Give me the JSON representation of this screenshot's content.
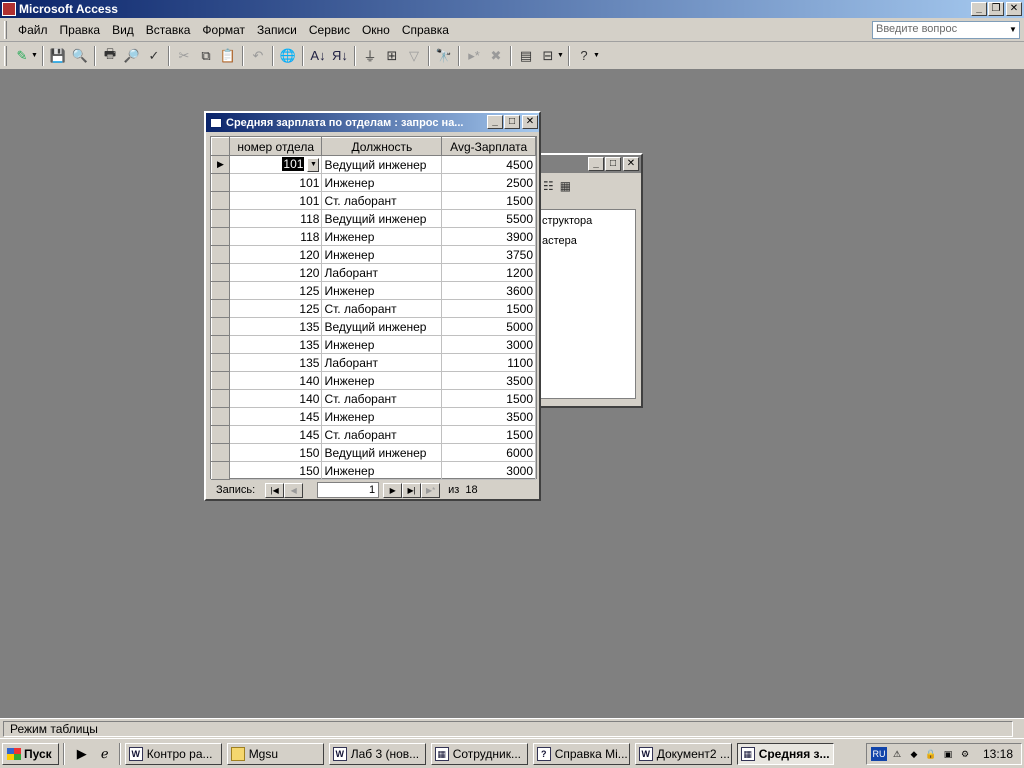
{
  "app": {
    "title": "Microsoft Access"
  },
  "menu": {
    "items": [
      "Файл",
      "Правка",
      "Вид",
      "Вставка",
      "Формат",
      "Записи",
      "Сервис",
      "Окно",
      "Справка"
    ],
    "question_placeholder": "Введите вопрос"
  },
  "toolbar": {
    "icons": [
      "design-view-icon",
      "save-icon",
      "file-search-icon",
      "print-icon",
      "print-preview-icon",
      "spelling-icon",
      "cut-icon",
      "copy-icon",
      "paste-icon",
      "undo-icon",
      "hyperlink-icon",
      "sort-ascending-icon",
      "sort-descending-icon",
      "filter-by-selection-icon",
      "filter-by-form-icon",
      "apply-filter-icon",
      "find-icon",
      "new-record-icon",
      "delete-record-icon",
      "database-window-icon",
      "new-object-icon",
      "help-icon"
    ]
  },
  "db_window": {
    "list_items": [
      "структора",
      "астера"
    ]
  },
  "query_window": {
    "title": "Средняя зарплата по отделам : запрос на...",
    "columns": [
      "номер отдела",
      "Должность",
      "Avg-Зарплата"
    ],
    "rows": [
      {
        "dept": "101",
        "position": "Ведущий инженер",
        "avg": "4500"
      },
      {
        "dept": "101",
        "position": "Инженер",
        "avg": "2500"
      },
      {
        "dept": "101",
        "position": "Ст. лаборант",
        "avg": "1500"
      },
      {
        "dept": "118",
        "position": "Ведущий инженер",
        "avg": "5500"
      },
      {
        "dept": "118",
        "position": "Инженер",
        "avg": "3900"
      },
      {
        "dept": "120",
        "position": "Инженер",
        "avg": "3750"
      },
      {
        "dept": "120",
        "position": "Лаборант",
        "avg": "1200"
      },
      {
        "dept": "125",
        "position": "Инженер",
        "avg": "3600"
      },
      {
        "dept": "125",
        "position": "Ст. лаборант",
        "avg": "1500"
      },
      {
        "dept": "135",
        "position": "Ведущий инженер",
        "avg": "5000"
      },
      {
        "dept": "135",
        "position": "Инженер",
        "avg": "3000"
      },
      {
        "dept": "135",
        "position": "Лаборант",
        "avg": "1100"
      },
      {
        "dept": "140",
        "position": "Инженер",
        "avg": "3500"
      },
      {
        "dept": "140",
        "position": "Ст. лаборант",
        "avg": "1500"
      },
      {
        "dept": "145",
        "position": "Инженер",
        "avg": "3500"
      },
      {
        "dept": "145",
        "position": "Ст. лаборант",
        "avg": "1500"
      },
      {
        "dept": "150",
        "position": "Ведущий инженер",
        "avg": "6000"
      },
      {
        "dept": "150",
        "position": "Инженер",
        "avg": "3000"
      }
    ],
    "nav": {
      "label": "Запись:",
      "current": "1",
      "of_label": "из",
      "total": "18"
    }
  },
  "status": {
    "text": "Режим таблицы"
  },
  "taskbar": {
    "start_label": "Пуск",
    "tasks": [
      {
        "label": "Контро ра...",
        "icon": "word-icon",
        "icon_char": "W"
      },
      {
        "label": "Mgsu",
        "icon": "folder-icon",
        "icon_char": ""
      },
      {
        "label": "Лаб 3 (нов...",
        "icon": "word-icon",
        "icon_char": "W"
      },
      {
        "label": "Сотрудник...",
        "icon": "access-table-icon",
        "icon_char": "▦"
      },
      {
        "label": "Справка Mi...",
        "icon": "help-book-icon",
        "icon_char": "?"
      },
      {
        "label": "Документ2 ...",
        "icon": "word-icon",
        "icon_char": "W"
      },
      {
        "label": "Средняя з...",
        "icon": "access-query-icon",
        "icon_char": "▦",
        "active": true
      }
    ],
    "tray": {
      "lang": "RU",
      "clock": "13:18"
    }
  }
}
